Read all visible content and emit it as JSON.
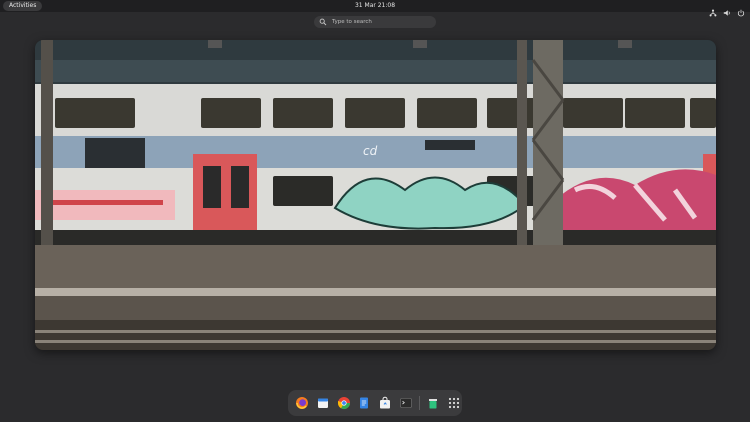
{
  "topbar": {
    "activities_label": "Activities",
    "clock": "31 Mar  21:08",
    "tray_icons": [
      "network-icon",
      "volume-icon",
      "power-icon"
    ]
  },
  "search": {
    "placeholder": "Type to search"
  },
  "window_preview": {
    "content": "train-wallpaper",
    "icon": "train-photo"
  },
  "dock": {
    "apps": [
      {
        "name": "firefox",
        "icon": "firefox-icon"
      },
      {
        "name": "calendar",
        "icon": "calendar-icon"
      },
      {
        "name": "chrome",
        "icon": "chrome-icon"
      },
      {
        "name": "text-editor",
        "icon": "document-icon"
      },
      {
        "name": "software",
        "icon": "software-bag-icon"
      },
      {
        "name": "terminal",
        "icon": "terminal-icon"
      },
      {
        "name": "trash",
        "icon": "trash-icon"
      },
      {
        "name": "app-grid",
        "icon": "grid-icon"
      }
    ]
  },
  "colors": {
    "accent": "#3584e4",
    "bg": "#2b2b2d",
    "bar": "#1f1f21"
  }
}
